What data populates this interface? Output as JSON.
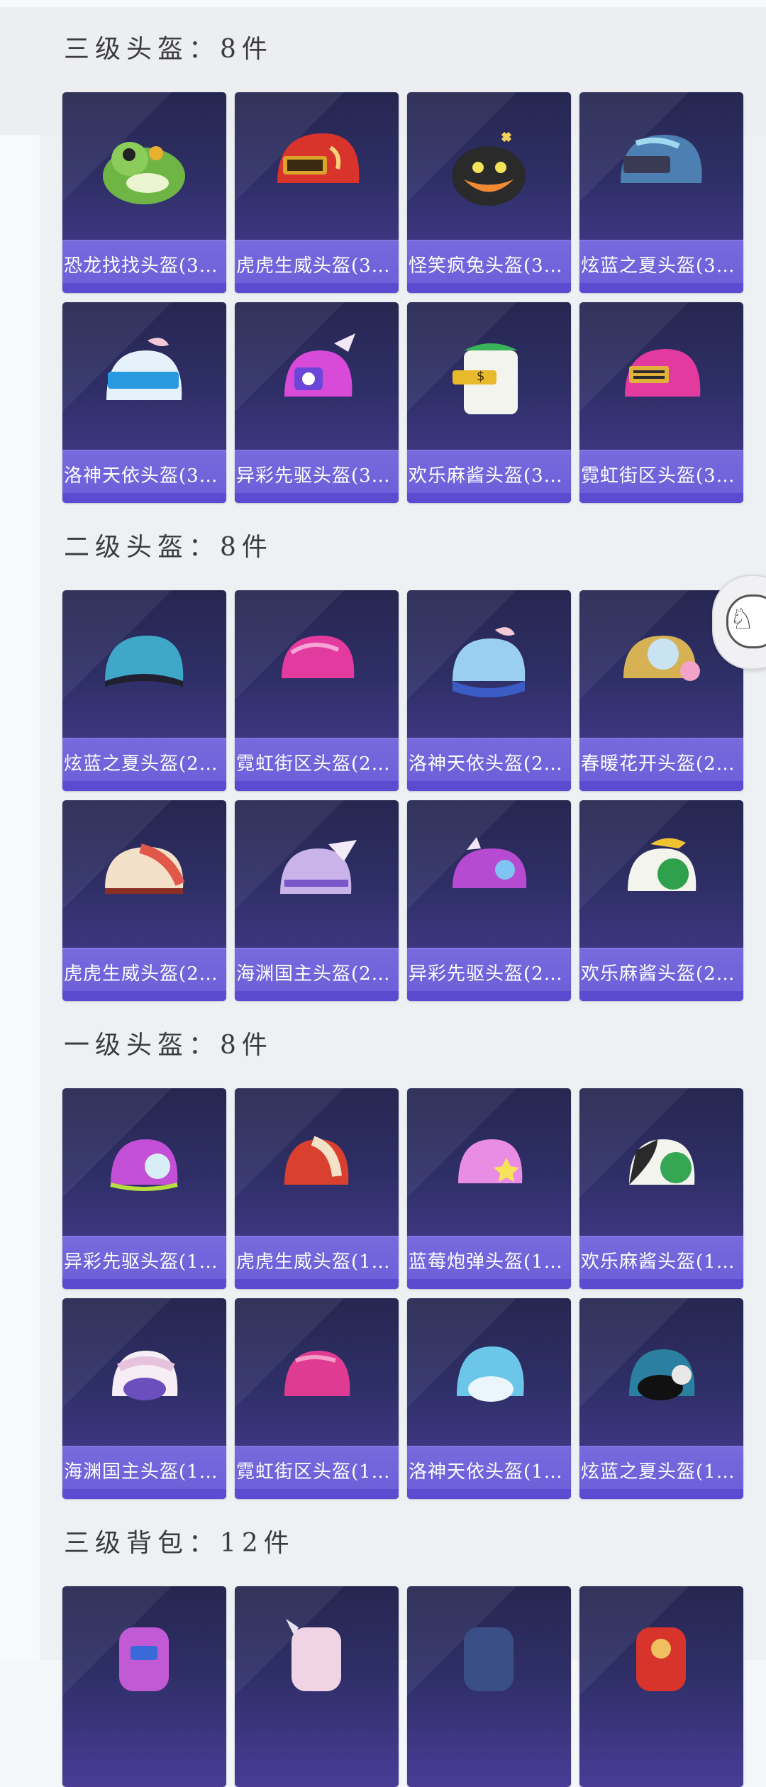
{
  "sections": [
    {
      "title": "三级头盔：8件",
      "items": [
        {
          "label": "恐龙找找头盔(3…",
          "icon": "dino-helmet-icon",
          "color": "#6fb545"
        },
        {
          "label": "虎虎生威头盔(3…",
          "icon": "tiger-helmet-icon",
          "color": "#d8342b"
        },
        {
          "label": "怪笑疯兔头盔(3…",
          "icon": "crazy-rabbit-helmet-icon",
          "color": "#2a2a2a"
        },
        {
          "label": "炫蓝之夏头盔(3…",
          "icon": "blue-summer-helmet-icon",
          "color": "#4d7fb2"
        },
        {
          "label": "洛神天依头盔(3…",
          "icon": "luoshen-helmet-icon",
          "color": "#8ec6f0"
        },
        {
          "label": "异彩先驱头盔(3…",
          "icon": "pioneer-helmet-icon",
          "color": "#d84ad8"
        },
        {
          "label": "欢乐麻酱头盔(3…",
          "icon": "mahjong-helmet-icon",
          "color": "#3ab25a"
        },
        {
          "label": "霓虹街区头盔(3…",
          "icon": "neon-helmet-icon",
          "color": "#e33aa0"
        }
      ]
    },
    {
      "title": "二级头盔：8件",
      "items": [
        {
          "label": "炫蓝之夏头盔(2…",
          "icon": "blue-summer-helmet-icon",
          "color": "#3fa8c9"
        },
        {
          "label": "霓虹街区头盔(2…",
          "icon": "neon-helmet-icon",
          "color": "#e33aa0"
        },
        {
          "label": "洛神天依头盔(2…",
          "icon": "luoshen-helmet-icon",
          "color": "#9bcff2"
        },
        {
          "label": "春暖花开头盔(2…",
          "icon": "spring-helmet-icon",
          "color": "#d6b255"
        },
        {
          "label": "虎虎生威头盔(2…",
          "icon": "tiger-helmet-icon",
          "color": "#e1584b"
        },
        {
          "label": "海渊国主头盔(2…",
          "icon": "abyss-helmet-icon",
          "color": "#c9b3e8"
        },
        {
          "label": "异彩先驱头盔(2…",
          "icon": "pioneer-helmet-icon",
          "color": "#b64ad0"
        },
        {
          "label": "欢乐麻酱头盔(2…",
          "icon": "mahjong-helmet-icon",
          "color": "#2fa04b"
        }
      ]
    },
    {
      "title": "一级头盔：8件",
      "items": [
        {
          "label": "异彩先驱头盔(1…",
          "icon": "pioneer-helmet-icon",
          "color": "#c34fd6"
        },
        {
          "label": "虎虎生威头盔(1…",
          "icon": "tiger-helmet-icon",
          "color": "#d9402f"
        },
        {
          "label": "蓝莓炮弹头盔(1…",
          "icon": "blueberry-helmet-icon",
          "color": "#e98ce3"
        },
        {
          "label": "欢乐麻酱头盔(1…",
          "icon": "mahjong-helmet-icon",
          "color": "#35a653"
        },
        {
          "label": "海渊国主头盔(1…",
          "icon": "abyss-helmet-icon",
          "color": "#e7c2dd"
        },
        {
          "label": "霓虹街区头盔(1…",
          "icon": "neon-helmet-icon",
          "color": "#e03b92"
        },
        {
          "label": "洛神天依头盔(1…",
          "icon": "luoshen-helmet-icon",
          "color": "#6cc6ea"
        },
        {
          "label": "炫蓝之夏头盔(1…",
          "icon": "blue-summer-helmet-icon",
          "color": "#2b7fa0"
        }
      ]
    },
    {
      "title": "三级背包：12件",
      "items": [
        {
          "label": "",
          "icon": "backpack-icon",
          "color": "#c25ad6"
        },
        {
          "label": "",
          "icon": "backpack-icon",
          "color": "#f0d4e6"
        },
        {
          "label": "",
          "icon": "backpack-icon",
          "color": "#3a4f86"
        },
        {
          "label": "",
          "icon": "backpack-icon",
          "color": "#d9342b"
        }
      ]
    }
  ]
}
